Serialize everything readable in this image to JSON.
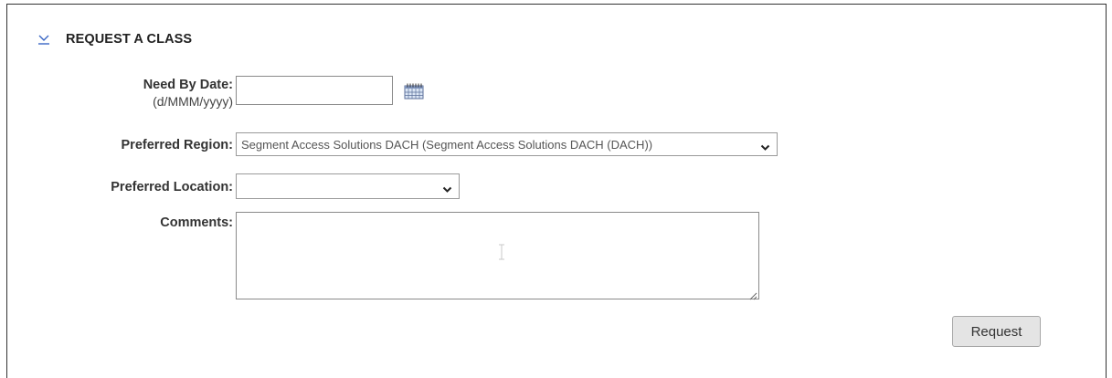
{
  "section": {
    "title": "REQUEST A CLASS",
    "collapse_icon": "chevron-down-underline-icon",
    "accent_color": "#3a66c4"
  },
  "form": {
    "need_by_date": {
      "label": "Need By Date:",
      "format_hint": "(d/MMM/yyyy)",
      "value": "",
      "calendar_icon": "calendar-icon"
    },
    "preferred_region": {
      "label": "Preferred Region:",
      "selected": "Segment Access Solutions DACH (Segment Access Solutions DACH (DACH))"
    },
    "preferred_location": {
      "label": "Preferred Location:",
      "selected": ""
    },
    "comments": {
      "label": "Comments:",
      "value": ""
    }
  },
  "actions": {
    "request_label": "Request"
  }
}
